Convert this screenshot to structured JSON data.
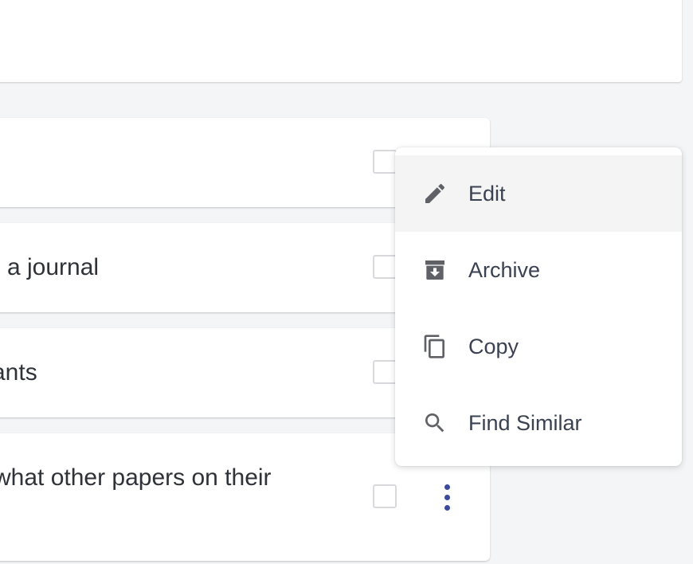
{
  "tasks": [
    {
      "text": ""
    },
    {
      "text": "a journal"
    },
    {
      "text": "ants"
    },
    {
      "text": "what other papers on their"
    }
  ],
  "context_menu": {
    "items": [
      {
        "label": "Edit",
        "icon": "pencil-icon",
        "highlighted": true
      },
      {
        "label": "Archive",
        "icon": "archive-icon",
        "highlighted": false
      },
      {
        "label": "Copy",
        "icon": "copy-icon",
        "highlighted": false
      },
      {
        "label": "Find Similar",
        "icon": "search-icon",
        "highlighted": false
      }
    ]
  },
  "colors": {
    "page_background": "#f4f5f7",
    "card_background": "#ffffff",
    "menu_highlight": "#f4f4f4",
    "more_dots": "#3b4a9a",
    "icon": "#5f6166",
    "menu_text": "#3a4150"
  }
}
